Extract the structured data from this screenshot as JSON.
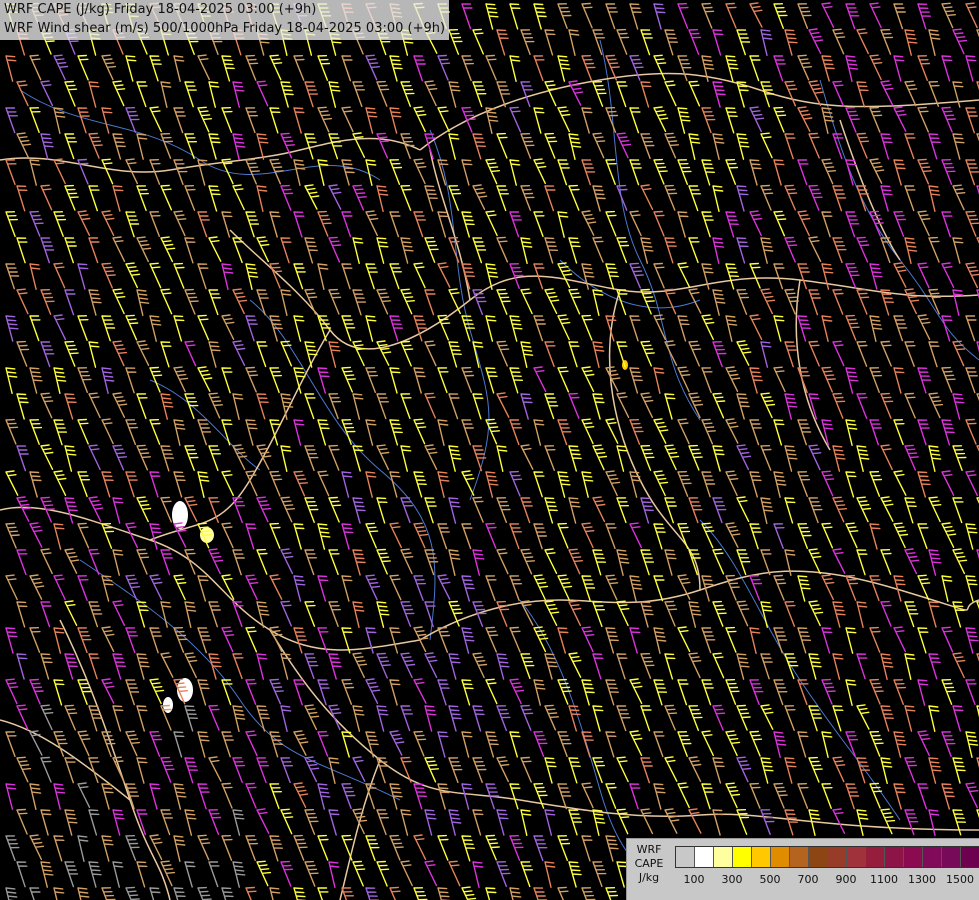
{
  "titles": {
    "line1": "WRF CAPE (J/kg) Friday 18-04-2025 03:00 (+9h)",
    "line2": "WRF Wind shear (m/s) 500/1000hPa Friday 18-04-2025 03:00 (+9h)"
  },
  "legend": {
    "model": "WRF",
    "variable": "CAPE",
    "unit": "J/kg",
    "colors": [
      "#c8c8c8",
      "#ffffff",
      "#ffffa0",
      "#ffff00",
      "#ffc800",
      "#e08c00",
      "#b4641e",
      "#8c4614",
      "#963c28",
      "#a0323c",
      "#961e3c",
      "#8c1446",
      "#8c0a50",
      "#820a5a",
      "#780a5a",
      "#6e0050"
    ],
    "ticks": [
      "100",
      "300",
      "500",
      "700",
      "900",
      "1100",
      "1300",
      "1500"
    ]
  },
  "map_colors": {
    "background": "#000000",
    "borders": "#e8c8a0",
    "rivers": "#4a78d0",
    "barbs_yellow": "#ffff3c",
    "barbs_tan": "#d2a064",
    "barbs_salmon": "#e6825a",
    "barbs_magenta": "#dc32dc",
    "barbs_violet": "#a064dc",
    "barbs_grey": "#9a9a9a"
  }
}
